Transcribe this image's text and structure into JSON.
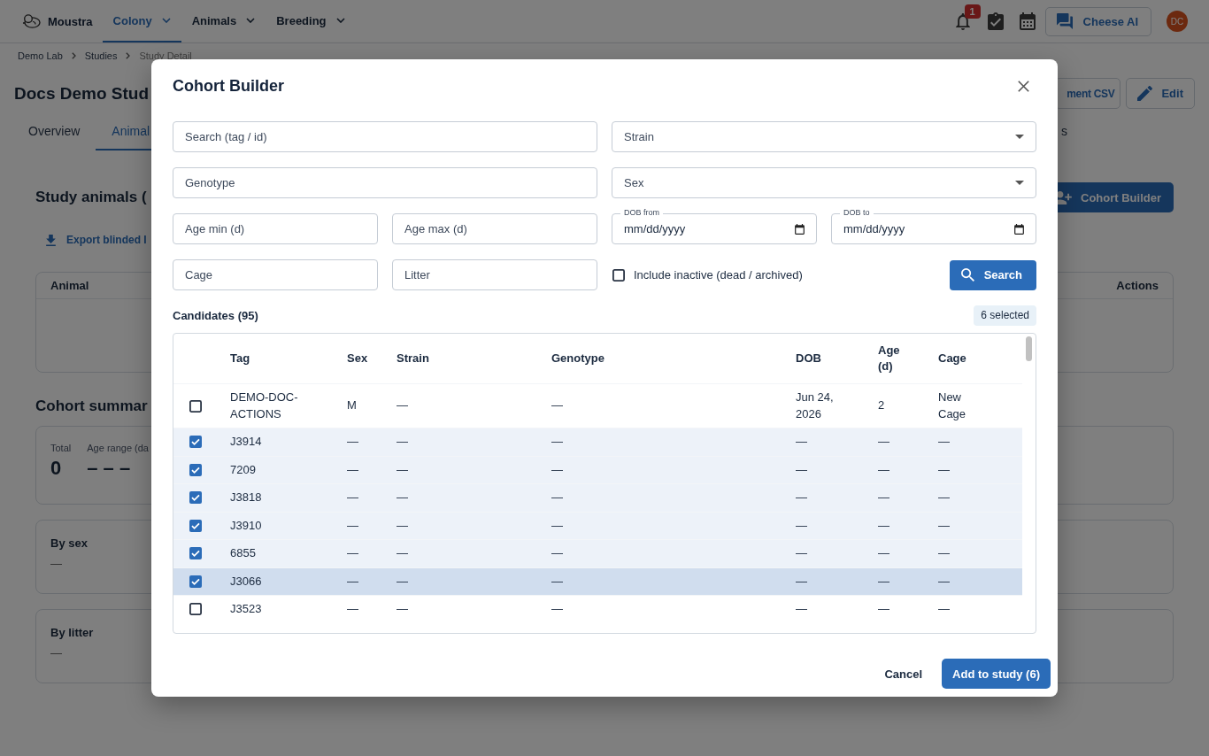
{
  "header": {
    "brand": "Moustra",
    "nav": [
      {
        "label": "Colony",
        "selected": true
      },
      {
        "label": "Animals",
        "selected": false
      },
      {
        "label": "Breeding",
        "selected": false
      }
    ],
    "notification_count": "1",
    "assistant_button": "Cheese AI",
    "avatar_initials": "DC"
  },
  "breadcrumb": [
    {
      "label": "Demo Lab",
      "current": false
    },
    {
      "label": "Studies",
      "current": false
    },
    {
      "label": "Study Detail",
      "current": true
    }
  ],
  "page": {
    "title": "Docs Demo Stud",
    "buttons": [
      {
        "kind": "plain",
        "label": "ment CSV"
      },
      {
        "kind": "edit",
        "label": "Edit"
      }
    ],
    "tabs": [
      {
        "label": "Overview",
        "selected": false
      },
      {
        "label": "Animal",
        "selected": true
      },
      {
        "label": "s",
        "selected": false
      }
    ],
    "section_title": "Study animals (",
    "cohort_builder_button": "Cohort Builder",
    "export_link": "Export blinded I",
    "animals_table": {
      "columns": [
        "Animal",
        "Actions"
      ]
    },
    "summary_title": "Cohort summar",
    "summary_stats": [
      {
        "label": "Total",
        "value": "0"
      },
      {
        "label": "Age range (da",
        "value": "– – –"
      }
    ],
    "breakdowns": [
      {
        "title": "By sex",
        "value": "—"
      },
      {
        "title": "By litter",
        "value": "—"
      }
    ]
  },
  "dialog": {
    "title": "Cohort Builder",
    "filter_rows": [
      [
        {
          "kind": "text",
          "placeholder": "Search (tag / id)"
        },
        {
          "kind": "select",
          "placeholder": "Strain"
        }
      ],
      [
        {
          "kind": "text",
          "placeholder": "Genotype"
        },
        {
          "kind": "select",
          "placeholder": "Sex"
        }
      ],
      [
        {
          "kind": "text",
          "placeholder": "Age min (d)"
        },
        {
          "kind": "text",
          "placeholder": "Age max (d)"
        },
        {
          "kind": "date",
          "label": "DOB from",
          "value": "mm/dd/yyyy"
        },
        {
          "kind": "date",
          "label": "DOB to",
          "value": "mm/dd/yyyy"
        }
      ],
      [
        {
          "kind": "text",
          "placeholder": "Cage"
        },
        {
          "kind": "text",
          "placeholder": "Litter"
        },
        {
          "kind": "checkbox",
          "label": "Include inactive (dead / archived)",
          "checked": false
        },
        {
          "kind": "button",
          "label": "Search"
        }
      ]
    ],
    "candidates_label": "Candidates (95)",
    "selected_count": "6 selected",
    "table": {
      "columns": [
        "Tag",
        "Sex",
        "Strain",
        "Genotype",
        "DOB",
        "Age (d)",
        "Cage"
      ],
      "rows": [
        {
          "selected": false,
          "hovered": false,
          "cells": [
            "DEMO-DOC-ACTIONS",
            "M",
            "—",
            "—",
            "Jun 24, 2026",
            "2",
            "New Cage"
          ]
        },
        {
          "selected": true,
          "hovered": false,
          "cells": [
            "J3914",
            "—",
            "—",
            "—",
            "—",
            "—",
            "—"
          ]
        },
        {
          "selected": true,
          "hovered": false,
          "cells": [
            "7209",
            "—",
            "—",
            "—",
            "—",
            "—",
            "—"
          ]
        },
        {
          "selected": true,
          "hovered": false,
          "cells": [
            "J3818",
            "—",
            "—",
            "—",
            "—",
            "—",
            "—"
          ]
        },
        {
          "selected": true,
          "hovered": false,
          "cells": [
            "J3910",
            "—",
            "—",
            "—",
            "—",
            "—",
            "—"
          ]
        },
        {
          "selected": true,
          "hovered": false,
          "cells": [
            "6855",
            "—",
            "—",
            "—",
            "—",
            "—",
            "—"
          ]
        },
        {
          "selected": true,
          "hovered": true,
          "cells": [
            "J3066",
            "—",
            "—",
            "—",
            "—",
            "—",
            "—"
          ]
        },
        {
          "selected": false,
          "hovered": false,
          "cells": [
            "J3523",
            "—",
            "—",
            "—",
            "—",
            "—",
            "—"
          ]
        }
      ]
    },
    "actions": [
      {
        "kind": "secondary",
        "label": "Cancel"
      },
      {
        "kind": "primary",
        "label": "Add to study (6)"
      }
    ]
  }
}
